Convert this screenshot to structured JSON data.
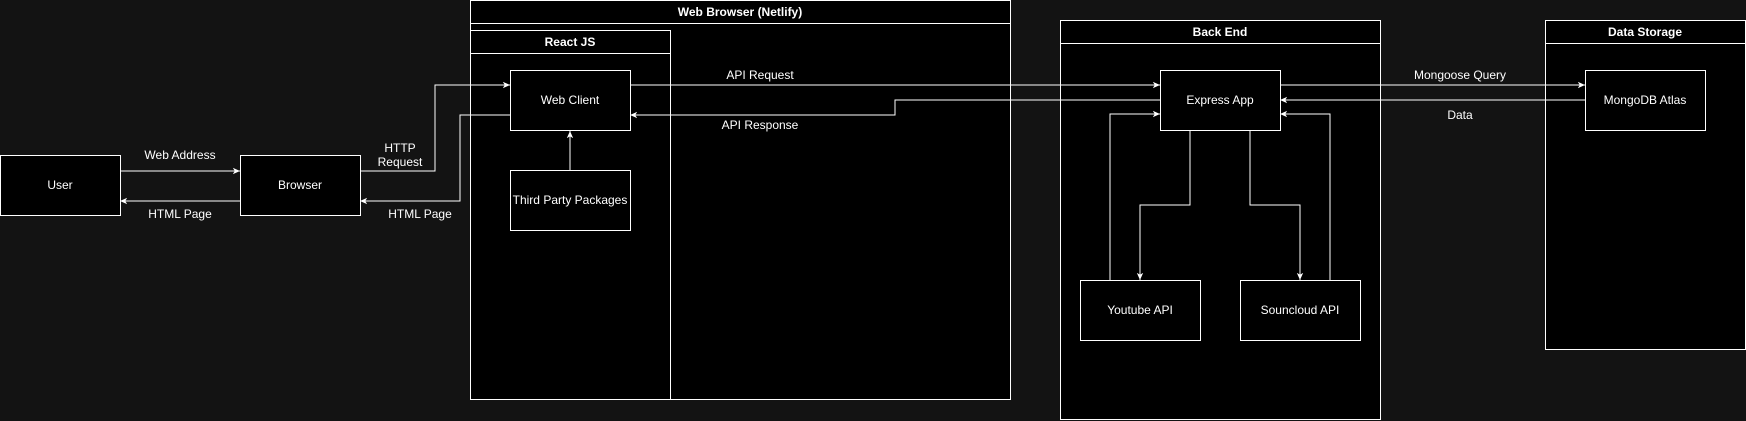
{
  "containers": {
    "web_browser": "Web Browser (Netlify)",
    "react_js": "React JS",
    "back_end": "Back End",
    "data_storage": "Data Storage"
  },
  "nodes": {
    "user": "User",
    "browser": "Browser",
    "web_client": "Web Client",
    "third_party": "Third Party Packages",
    "express_app": "Express App",
    "youtube_api": "Youtube API",
    "soundcloud_api": "Souncloud API",
    "mongodb_atlas": "MongoDB Atlas"
  },
  "edges": {
    "web_address": "Web Address",
    "html_page_user": "HTML Page",
    "http_request_line1": "HTTP",
    "http_request_line2": "Request",
    "html_page_browser": "HTML Page",
    "api_request": "API Request",
    "api_response": "API Response",
    "mongoose_query": "Mongoose Query",
    "data": "Data"
  },
  "colors": {
    "background": "#131313",
    "shape_fill": "#000000",
    "stroke": "#ffffff",
    "text": "#ffffff"
  }
}
